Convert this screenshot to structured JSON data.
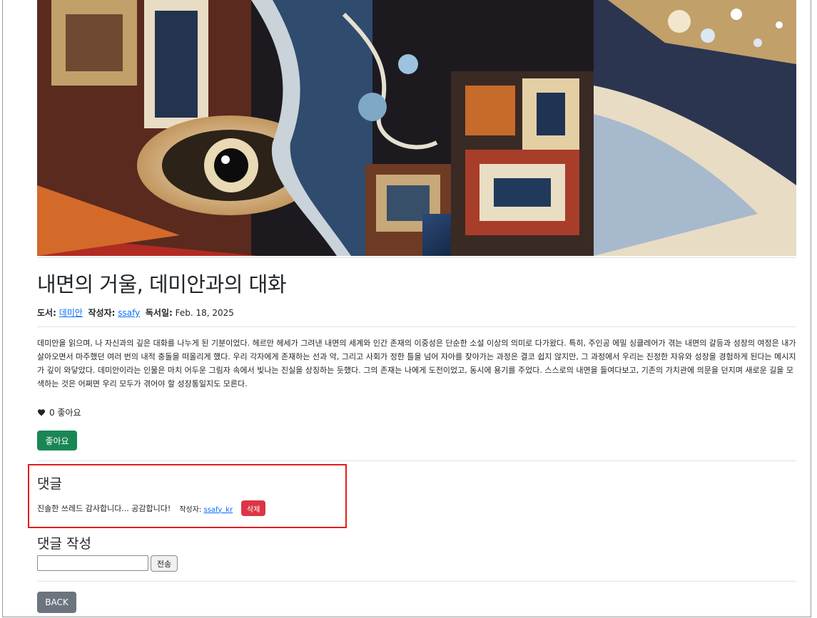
{
  "post": {
    "title": "내면의 거울, 데미안과의 대화",
    "book_label": "도서:",
    "book": "데미안",
    "author_label": "작성자:",
    "author": "ssafy",
    "date_label": "독서일:",
    "date": "Feb. 18, 2025",
    "content": "데미안을 읽으며, 나 자신과의 깊은 대화를 나누게 된 기분이었다. 헤르만 헤세가 그려낸 내면의 세계와 인간 존재의 이중성은 단순한 소설 이상의 의미로 다가왔다. 특히, 주인공 에밀 싱클레어가 겪는 내면의 갈등과 성장의 여정은 내가 살아오면서 마주했던 여러 번의 내적 충돌을 떠올리게 했다. 우리 각자에게 존재하는 선과 악, 그리고 사회가 정한 틀을 넘어 자아를 찾아가는 과정은 결코 쉽지 않지만, 그 과정에서 우리는 진정한 자유와 성장을 경험하게 된다는 메시지가 깊이 와닿았다. 데미안이라는 인물은 마치 어두운 그림자 속에서 빛나는 진실을 상징하는 듯했다. 그의 존재는 나에게 도전이었고, 동시에 용기를 주었다. 스스로의 내면을 들여다보고, 기존의 가치관에 의문을 던지며 새로운 길을 모색하는 것은 어쩌면 우리 모두가 겪어야 할 성장통일지도 모른다.",
    "likes_text": "0 좋아요",
    "like_button": "좋아요"
  },
  "comments": {
    "heading": "댓글",
    "items": [
      {
        "text": "진솔한 쓰레드 감사합니다... 공감합니다!",
        "author_label": "작성자:",
        "author": "ssafy_kr",
        "delete_label": "삭제"
      }
    ]
  },
  "comment_form": {
    "heading": "댓글 작성",
    "input_value": "",
    "submit_label": "전송"
  },
  "back_label": "BACK",
  "colors": {
    "like": "#198754",
    "delete": "#dc3545",
    "back": "#6c757d",
    "link": "#0d6efd",
    "highlight": "#e01e1e"
  },
  "icons": {
    "likes": "heart-icon"
  }
}
